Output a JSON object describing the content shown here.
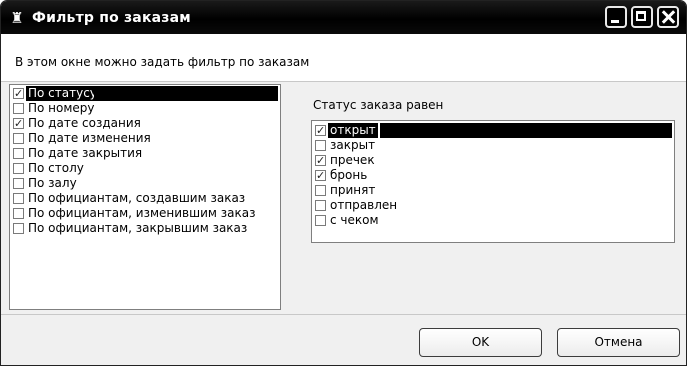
{
  "window": {
    "title": "Фильтр по заказам",
    "app_icon": "person-icon"
  },
  "info": {
    "text": "В этом окне можно задать фильтр по заказам"
  },
  "filters": {
    "items": [
      {
        "label": "По статусу",
        "checked": true,
        "selected": true
      },
      {
        "label": "По номеру",
        "checked": false,
        "selected": false
      },
      {
        "label": "По дате создания",
        "checked": true,
        "selected": false
      },
      {
        "label": "По дате изменения",
        "checked": false,
        "selected": false
      },
      {
        "label": "По дате закрытия",
        "checked": false,
        "selected": false
      },
      {
        "label": "По столу",
        "checked": false,
        "selected": false
      },
      {
        "label": "По залу",
        "checked": false,
        "selected": false
      },
      {
        "label": "По официантам, создавшим заказ",
        "checked": false,
        "selected": false
      },
      {
        "label": "По официантам, изменившим заказ",
        "checked": false,
        "selected": false
      },
      {
        "label": "По официантам, закрывшим заказ",
        "checked": false,
        "selected": false
      }
    ]
  },
  "status_panel": {
    "label": "Статус заказа равен",
    "items": [
      {
        "label": "открыт",
        "checked": true,
        "selected": true
      },
      {
        "label": "закрыт",
        "checked": false,
        "selected": false
      },
      {
        "label": "пречек",
        "checked": true,
        "selected": false
      },
      {
        "label": "бронь",
        "checked": true,
        "selected": false
      },
      {
        "label": "принят",
        "checked": false,
        "selected": false
      },
      {
        "label": "отправлен",
        "checked": false,
        "selected": false
      },
      {
        "label": "с чеком",
        "checked": false,
        "selected": false
      }
    ]
  },
  "buttons": {
    "ok": "OK",
    "cancel": "Отмена"
  }
}
